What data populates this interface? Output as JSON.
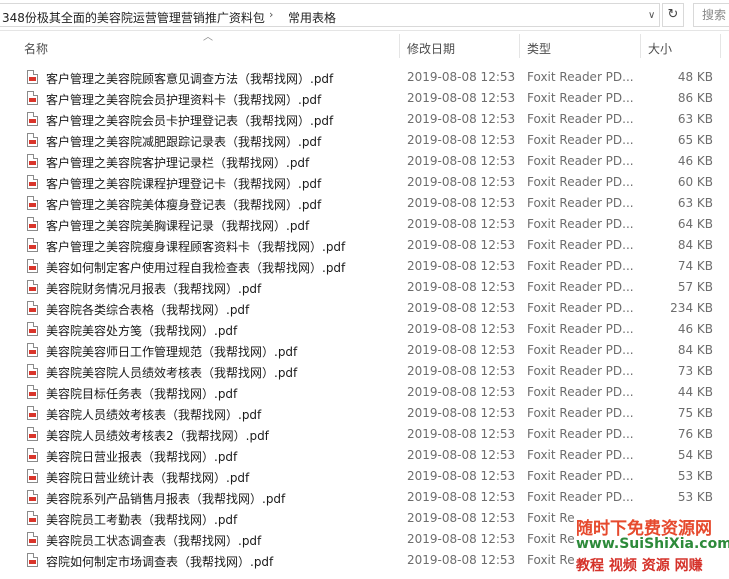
{
  "address": {
    "crumbs": [
      "348份极其全面的美容院运营管理营销推广资料包",
      "常用表格"
    ],
    "search_placeholder": "搜索"
  },
  "icons": {
    "breadcrumb_separator": "chevron-right-icon",
    "dropdown": "chevron-down-icon",
    "refresh": "refresh-icon",
    "file": "pdf-file-icon"
  },
  "colors": {
    "pdf_icon_accent": "#d9352b"
  },
  "columns": {
    "name": "名称",
    "date": "修改日期",
    "type": "类型",
    "size": "大小"
  },
  "files": [
    {
      "name": "客户管理之美容院顾客意见调查方法（我帮找网）.pdf",
      "date": "2019-08-08 12:53",
      "type": "Foxit Reader PD...",
      "size": "48 KB"
    },
    {
      "name": "客户管理之美容院会员护理资料卡（我帮找网）.pdf",
      "date": "2019-08-08 12:53",
      "type": "Foxit Reader PD...",
      "size": "86 KB"
    },
    {
      "name": "客户管理之美容院会员卡护理登记表（我帮找网）.pdf",
      "date": "2019-08-08 12:53",
      "type": "Foxit Reader PD...",
      "size": "63 KB"
    },
    {
      "name": "客户管理之美容院减肥跟踪记录表（我帮找网）.pdf",
      "date": "2019-08-08 12:53",
      "type": "Foxit Reader PD...",
      "size": "65 KB"
    },
    {
      "name": "客户管理之美容院客护理记录栏（我帮找网）.pdf",
      "date": "2019-08-08 12:53",
      "type": "Foxit Reader PD...",
      "size": "46 KB"
    },
    {
      "name": "客户管理之美容院课程护理登记卡（我帮找网）.pdf",
      "date": "2019-08-08 12:53",
      "type": "Foxit Reader PD...",
      "size": "60 KB"
    },
    {
      "name": "客户管理之美容院美体瘦身登记表（我帮找网）.pdf",
      "date": "2019-08-08 12:53",
      "type": "Foxit Reader PD...",
      "size": "63 KB"
    },
    {
      "name": "客户管理之美容院美胸课程记录（我帮找网）.pdf",
      "date": "2019-08-08 12:53",
      "type": "Foxit Reader PD...",
      "size": "64 KB"
    },
    {
      "name": "客户管理之美容院瘦身课程顾客资料卡（我帮找网）.pdf",
      "date": "2019-08-08 12:53",
      "type": "Foxit Reader PD...",
      "size": "84 KB"
    },
    {
      "name": "美容如何制定客户使用过程自我检查表（我帮找网）.pdf",
      "date": "2019-08-08 12:53",
      "type": "Foxit Reader PD...",
      "size": "74 KB"
    },
    {
      "name": "美容院财务情况月报表（我帮找网）.pdf",
      "date": "2019-08-08 12:53",
      "type": "Foxit Reader PD...",
      "size": "57 KB"
    },
    {
      "name": "美容院各类综合表格（我帮找网）.pdf",
      "date": "2019-08-08 12:53",
      "type": "Foxit Reader PD...",
      "size": "234 KB"
    },
    {
      "name": "美容院美容处方笺（我帮找网）.pdf",
      "date": "2019-08-08 12:53",
      "type": "Foxit Reader PD...",
      "size": "46 KB"
    },
    {
      "name": "美容院美容师日工作管理规范（我帮找网）.pdf",
      "date": "2019-08-08 12:53",
      "type": "Foxit Reader PD...",
      "size": "84 KB"
    },
    {
      "name": "美容院美容院人员绩效考核表（我帮找网）.pdf",
      "date": "2019-08-08 12:53",
      "type": "Foxit Reader PD...",
      "size": "73 KB"
    },
    {
      "name": "美容院目标任务表（我帮找网）.pdf",
      "date": "2019-08-08 12:53",
      "type": "Foxit Reader PD...",
      "size": "44 KB"
    },
    {
      "name": "美容院人员绩效考核表（我帮找网）.pdf",
      "date": "2019-08-08 12:53",
      "type": "Foxit Reader PD...",
      "size": "75 KB"
    },
    {
      "name": "美容院人员绩效考核表2（我帮找网）.pdf",
      "date": "2019-08-08 12:53",
      "type": "Foxit Reader PD...",
      "size": "76 KB"
    },
    {
      "name": "美容院日营业报表（我帮找网）.pdf",
      "date": "2019-08-08 12:53",
      "type": "Foxit Reader PD...",
      "size": "54 KB"
    },
    {
      "name": "美容院日营业统计表（我帮找网）.pdf",
      "date": "2019-08-08 12:53",
      "type": "Foxit Reader PD...",
      "size": "53 KB"
    },
    {
      "name": "美容院系列产品销售月报表（我帮找网）.pdf",
      "date": "2019-08-08 12:53",
      "type": "Foxit Reader PD...",
      "size": "53 KB"
    },
    {
      "name": "美容院员工考勤表（我帮找网）.pdf",
      "date": "2019-08-08 12:53",
      "type": "Foxit Re",
      "size": ""
    },
    {
      "name": "美容院员工状态调查表（我帮找网）.pdf",
      "date": "2019-08-08 12:53",
      "type": "Foxit Re",
      "size": ""
    },
    {
      "name": "容院如何制定市场调查表（我帮找网）.pdf",
      "date": "2019-08-08 12:53",
      "type": "Foxit Re",
      "size": ""
    }
  ],
  "watermark": {
    "line1": "随时下免费资源网",
    "line2": "www.SuiShiXia.com",
    "line3": "教程 视频 资源 网赚"
  }
}
